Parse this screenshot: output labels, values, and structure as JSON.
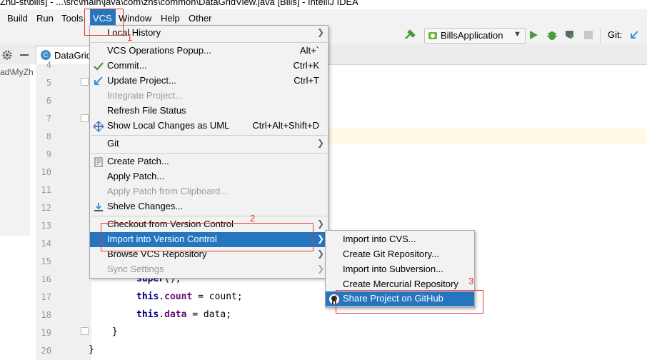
{
  "window": {
    "title": "Zhu-st\\bills] - ...\\src\\main\\java\\com\\zhs\\common\\DataGridView.java [Bills] - IntelliJ IDEA"
  },
  "menubar": {
    "items": [
      "Build",
      "Run",
      "Tools",
      "VCS",
      "Window",
      "Help",
      "Other"
    ],
    "active": "VCS"
  },
  "toolbar": {
    "run_config": "BillsApplication",
    "git_label": "Git:"
  },
  "tabs": {
    "active_tab": "DataGridView.java",
    "breadcrumb": "ad\\MyZh"
  },
  "editor": {
    "line_numbers": [
      "4",
      "5",
      "6",
      "7",
      "8",
      "9",
      "10",
      "11",
      "12",
      "13",
      "14",
      "15",
      "16",
      "17",
      "18",
      "19",
      "20"
    ],
    "code": {
      "line16": [
        "super",
        "();"
      ],
      "line17": [
        "this",
        ".",
        "count",
        " = count;"
      ],
      "line18": [
        "this",
        ".",
        "data",
        " = data;"
      ],
      "line19": "}",
      "line20": "}"
    }
  },
  "vcs_menu": {
    "items": [
      {
        "label": "Local History",
        "shortcut": "",
        "submenu": true
      },
      {
        "label": "VCS Operations Popup...",
        "shortcut": "Alt+`"
      },
      {
        "label": "Commit...",
        "shortcut": "Ctrl+K",
        "icon": "checkmark-icon"
      },
      {
        "label": "Update Project...",
        "shortcut": "Ctrl+T",
        "icon": "update-arrow-icon"
      },
      {
        "label": "Integrate Project...",
        "shortcut": "",
        "disabled": true
      },
      {
        "label": "Refresh File Status",
        "shortcut": ""
      },
      {
        "label": "Show Local Changes as UML",
        "shortcut": "Ctrl+Alt+Shift+D",
        "icon": "uml-icon"
      },
      {
        "label": "Git",
        "shortcut": "",
        "submenu": true
      },
      {
        "label": "Create Patch...",
        "shortcut": "",
        "icon": "patch-icon"
      },
      {
        "label": "Apply Patch...",
        "shortcut": ""
      },
      {
        "label": "Apply Patch from Clipboard...",
        "shortcut": "",
        "disabled": true
      },
      {
        "label": "Shelve Changes...",
        "shortcut": "",
        "icon": "shelve-icon"
      },
      {
        "label": "Checkout from Version Control",
        "shortcut": "",
        "submenu": true
      },
      {
        "label": "Import into Version Control",
        "shortcut": "",
        "submenu": true,
        "highlighted": true
      },
      {
        "label": "Browse VCS Repository",
        "shortcut": "",
        "submenu": true
      },
      {
        "label": "Sync Settings",
        "shortcut": "",
        "disabled": true,
        "submenu": true
      }
    ]
  },
  "import_submenu": {
    "items": [
      {
        "label": "Import into CVS..."
      },
      {
        "label": "Create Git Repository..."
      },
      {
        "label": "Import into Subversion..."
      },
      {
        "label": "Create Mercurial Repository"
      },
      {
        "label": "Share Project on GitHub",
        "highlighted": true,
        "icon": "github-icon"
      }
    ]
  },
  "annotations": [
    "1",
    "2",
    "3"
  ],
  "colors": {
    "highlight": "#2675bf",
    "annotation": "#e53935",
    "menu_bg": "#f2f2f2",
    "current_line": "#fffae3"
  }
}
